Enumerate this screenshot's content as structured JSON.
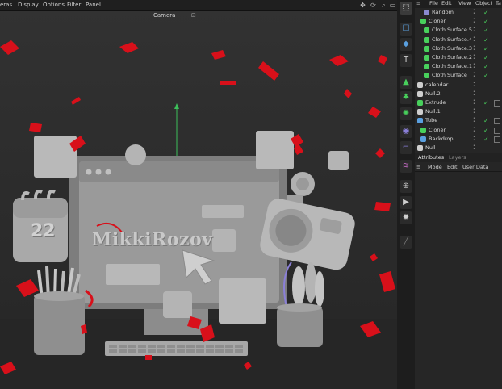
{
  "viewport": {
    "menu": [
      "eras",
      "Display",
      "Options",
      "Filter",
      "Panel"
    ],
    "camera_label": "Camera",
    "camera_ctrl": "⁰",
    "scene_text": "MikkiRozov",
    "calendar_number": "22"
  },
  "objects": {
    "menu": [
      "File",
      "Edit",
      "View",
      "Object",
      "Ta"
    ],
    "rows": [
      {
        "label": "Random",
        "icon_color": "#8a8ad0"
      },
      {
        "label": "Cloner",
        "icon_color": "#48d05c"
      },
      {
        "label": "Cloth Surface.5",
        "icon_color": "#48d05c"
      },
      {
        "label": "Cloth Surface.4",
        "icon_color": "#48d05c"
      },
      {
        "label": "Cloth Surface.3",
        "icon_color": "#48d05c"
      },
      {
        "label": "Cloth Surface.2",
        "icon_color": "#48d05c"
      },
      {
        "label": "Cloth Surface.1",
        "icon_color": "#48d05c"
      },
      {
        "label": "Cloth Surface",
        "icon_color": "#48d05c"
      },
      {
        "label": "calendar",
        "icon_color": "#cfcfcf"
      },
      {
        "label": "Null.2",
        "icon_color": "#cfcfcf"
      },
      {
        "label": "Extrude",
        "icon_color": "#48d05c"
      },
      {
        "label": "Null.1",
        "icon_color": "#cfcfcf"
      },
      {
        "label": "Tube",
        "icon_color": "#5aa0e0"
      },
      {
        "label": "Cloner",
        "icon_color": "#48d05c"
      },
      {
        "label": "Backdrop",
        "icon_color": "#5aa0e0"
      },
      {
        "label": "Null",
        "icon_color": "#cfcfcf"
      }
    ]
  },
  "attributes": {
    "tabs": [
      "Attributes",
      "Layers"
    ],
    "menu": [
      "Mode",
      "Edit",
      "User Data"
    ]
  },
  "toolbar": {
    "icons": [
      "selection-icon",
      "cube-icon",
      "text-icon",
      "cloth-icon",
      "cloner-icon",
      "mograph-icon",
      "deformer-icon",
      "field-icon",
      "spline-icon",
      "sphere-icon",
      "camera-icon",
      "light-icon",
      "pen-icon"
    ]
  },
  "colors": {
    "accent_green": "#48d05c",
    "accent_blue": "#5aa0e0",
    "confetti": "#d8101a"
  }
}
